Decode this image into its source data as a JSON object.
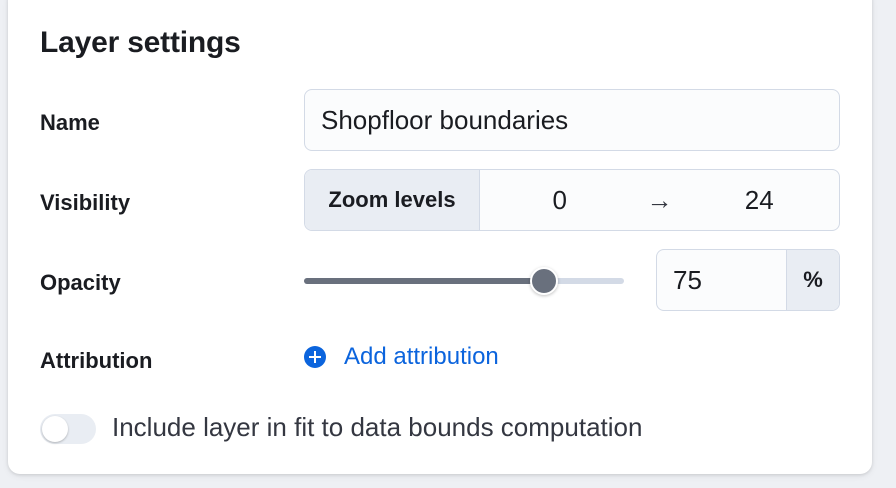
{
  "panel": {
    "title": "Layer settings"
  },
  "name": {
    "label": "Name",
    "value": "Shopfloor boundaries"
  },
  "visibility": {
    "label": "Visibility",
    "prepend": "Zoom levels",
    "min": "0",
    "arrow": "→",
    "max": "24"
  },
  "opacity": {
    "label": "Opacity",
    "value": "75",
    "unit": "%",
    "slider_fraction": 0.75
  },
  "attribution": {
    "label": "Attribution",
    "link_label": "Add attribution",
    "icon": "plus-circle-icon"
  },
  "fit_to_bounds": {
    "label": "Include layer in fit to data bounds computation",
    "enabled": false
  },
  "colors": {
    "accent": "#0b64dd",
    "slider": "#69707d",
    "track": "#d3dae6"
  }
}
